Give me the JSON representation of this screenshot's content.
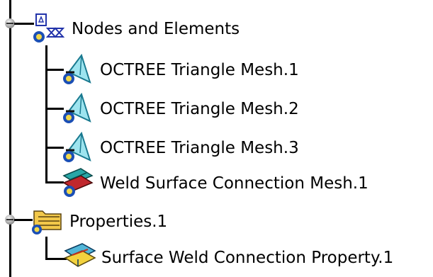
{
  "tree": {
    "nodes_elements": {
      "label": "Nodes and Elements",
      "icon": "nodes-elements-icon",
      "children": [
        {
          "label": "OCTREE Triangle Mesh.1",
          "icon": "octree-mesh-icon"
        },
        {
          "label": "OCTREE Triangle Mesh.2",
          "icon": "octree-mesh-icon"
        },
        {
          "label": "OCTREE Triangle Mesh.3",
          "icon": "octree-mesh-icon"
        },
        {
          "label": "Weld Surface Connection Mesh.1",
          "icon": "weld-mesh-icon"
        }
      ]
    },
    "properties": {
      "label": "Properties.1",
      "icon": "properties-folder-icon",
      "children": [
        {
          "label": "Surface Weld Connection Property.1",
          "icon": "weld-property-icon"
        }
      ]
    }
  }
}
